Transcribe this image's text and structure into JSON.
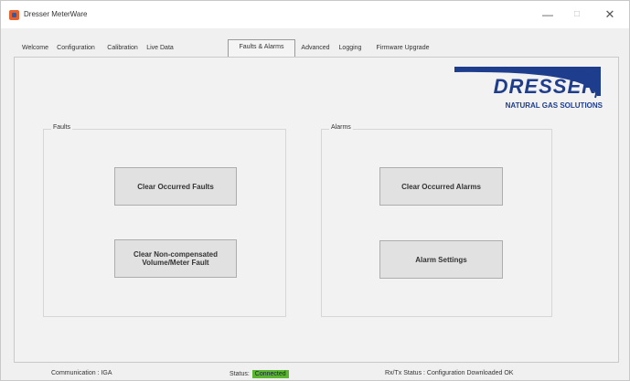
{
  "window": {
    "title": "Dresser MeterWare"
  },
  "titlebar": {
    "minimize": "—",
    "maximize": "□",
    "close": "✕"
  },
  "tabs": [
    {
      "label": "Welcome",
      "active": false
    },
    {
      "label": "Configuration",
      "active": false
    },
    {
      "label": "Calibration",
      "active": false
    },
    {
      "label": "Live Data",
      "active": false
    },
    {
      "label": "Faults & Alarms",
      "active": true
    },
    {
      "label": "Advanced",
      "active": false
    },
    {
      "label": "Logging",
      "active": false
    },
    {
      "label": "Firmware Upgrade",
      "active": false
    }
  ],
  "logo": {
    "brand": "DRESSER",
    "tagline": "NATURAL GAS SOLUTIONS",
    "color": "#1e3d8c"
  },
  "faults": {
    "group_label": "Faults",
    "clear_occurred": "Clear Occurred Faults",
    "clear_noncomp": "Clear Non-compensated Volume/Meter Fault"
  },
  "alarms": {
    "group_label": "Alarms",
    "clear_occurred": "Clear Occurred Alarms",
    "settings": "Alarm Settings"
  },
  "statusbar": {
    "communication": "Communication : IGA",
    "status_label": "Status:",
    "status_value": "Connected",
    "status_color": "#5cb531",
    "rxtx": "Rx/Tx Status : Configuration Downloaded OK"
  }
}
